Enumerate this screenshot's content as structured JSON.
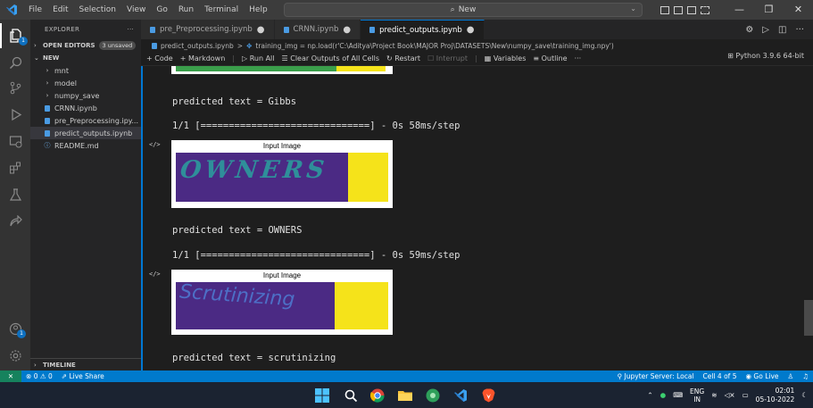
{
  "titlebar": {
    "menu": [
      "File",
      "Edit",
      "Selection",
      "View",
      "Go",
      "Run",
      "Terminal",
      "Help"
    ],
    "search": "New"
  },
  "activity": {
    "explorer_badge": "1",
    "accounts_badge": "1"
  },
  "sidebar": {
    "title": "EXPLORER",
    "more": "···",
    "open_editors": {
      "label": "OPEN EDITORS",
      "badge": "3 unsaved"
    },
    "folder": "NEW",
    "items": [
      {
        "label": "mnt",
        "kind": "folder"
      },
      {
        "label": "model",
        "kind": "folder"
      },
      {
        "label": "numpy_save",
        "kind": "folder"
      },
      {
        "label": "CRNN.ipynb",
        "kind": "notebook"
      },
      {
        "label": "pre_Preprocessing.ipy...",
        "kind": "notebook"
      },
      {
        "label": "predict_outputs.ipynb",
        "kind": "notebook"
      },
      {
        "label": "README.md",
        "kind": "info"
      }
    ],
    "timeline": "TIMELINE"
  },
  "tabs": [
    {
      "label": "pre_Preprocessing.ipynb",
      "dirty": "●"
    },
    {
      "label": "CRNN.ipynb",
      "dirty": "●"
    },
    {
      "label": "predict_outputs.ipynb",
      "dirty": "●"
    }
  ],
  "breadcrumb": {
    "file": "predict_outputs.ipynb",
    "sep": ">",
    "symbol": "training_img = np.load(r'C:\\Aditya\\Project Book\\MAJOR Proj\\DATASETS\\New\\numpy_save\\training_img.npy')"
  },
  "toolbar": {
    "code": "Code",
    "markdown": "Markdown",
    "run_all": "Run All",
    "clear": "Clear Outputs of All Cells",
    "restart": "Restart",
    "interrupt": "Interrupt",
    "variables": "Variables",
    "outline": "Outline",
    "more": "···",
    "kernel": "Python 3.9.6 64-bit"
  },
  "outputs": {
    "pred1": "predicted text = Gibbs",
    "progress1": "1/1 [==============================] - 0s 58ms/step",
    "fig_title_1": "Input Image",
    "image_word_1": "OWNERS",
    "pred2": "predicted text = OWNERS",
    "progress2": "1/1 [==============================] - 0s 59ms/step",
    "fig_title_2": "Input Image",
    "image_word_2": "Scrutinizing",
    "pred3": "predicted text = scrutinizing",
    "code_icon": "</>"
  },
  "statusbar": {
    "errors": "0",
    "warnings": "0",
    "liveshare": "Live Share",
    "jupyter": "Jupyter Server: Local",
    "cell": "Cell 4 of 5",
    "golive": "Go Live"
  },
  "taskbar": {
    "lang_top": "ENG",
    "lang_bottom": "IN",
    "time": "02:01",
    "date": "05-10-2022"
  },
  "colors": {
    "accent": "#007acc",
    "image_purple": "#4b2a84",
    "image_yellow": "#f5e31a"
  }
}
